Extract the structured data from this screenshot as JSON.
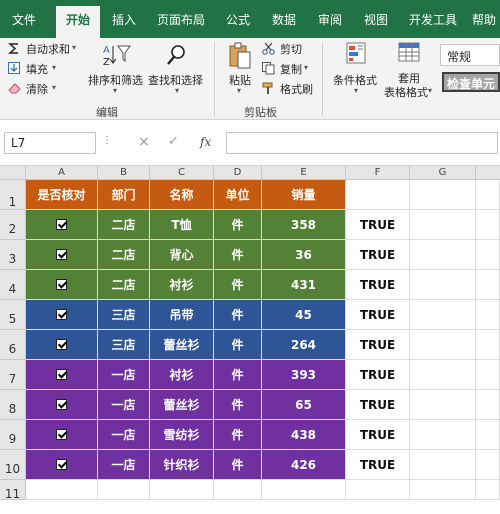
{
  "tabs": [
    "文件",
    "开始",
    "插入",
    "页面布局",
    "公式",
    "数据",
    "审阅",
    "视图",
    "开发工具",
    "帮助"
  ],
  "ribbon": {
    "autosum": "自动求和",
    "fill": "填充",
    "clear": "清除",
    "sort_filter": "排序和筛选",
    "find_select": "查找和选择",
    "editing_group": "编辑",
    "paste": "粘贴",
    "cut": "剪切",
    "copy": "复制",
    "format_painter": "格式刷",
    "clipboard_group": "剪贴板",
    "conditional_format": "条件格式",
    "table_format_line1": "套用",
    "table_format_line2": "表格格式",
    "number_format": "常规",
    "check_cell": "检查单元"
  },
  "formula_bar": {
    "name_box": "L7",
    "cancel": "×",
    "enter": "✓",
    "fx": "fx",
    "formula": ""
  },
  "columns": [
    "A",
    "B",
    "C",
    "D",
    "E",
    "F",
    "G"
  ],
  "rows": [
    "1",
    "2",
    "3",
    "4",
    "5",
    "6",
    "7",
    "8",
    "9",
    "10",
    "11"
  ],
  "headers": [
    "是否核对",
    "部门",
    "名称",
    "单位",
    "销量"
  ],
  "data": [
    {
      "dept": "二店",
      "name": "T恤",
      "unit": "件",
      "qty": "358",
      "f": "TRUE",
      "color": "#538135"
    },
    {
      "dept": "二店",
      "name": "背心",
      "unit": "件",
      "qty": "36",
      "f": "TRUE",
      "color": "#538135"
    },
    {
      "dept": "二店",
      "name": "衬衫",
      "unit": "件",
      "qty": "431",
      "f": "TRUE",
      "color": "#538135"
    },
    {
      "dept": "三店",
      "name": "吊带",
      "unit": "件",
      "qty": "45",
      "f": "TRUE",
      "color": "#2e5597"
    },
    {
      "dept": "三店",
      "name": "蕾丝衫",
      "unit": "件",
      "qty": "264",
      "f": "TRUE",
      "color": "#2e5597"
    },
    {
      "dept": "一店",
      "name": "衬衫",
      "unit": "件",
      "qty": "393",
      "f": "TRUE",
      "color": "#7030a0"
    },
    {
      "dept": "一店",
      "name": "蕾丝衫",
      "unit": "件",
      "qty": "65",
      "f": "TRUE",
      "color": "#7030a0"
    },
    {
      "dept": "一店",
      "name": "雪纺衫",
      "unit": "件",
      "qty": "438",
      "f": "TRUE",
      "color": "#7030a0"
    },
    {
      "dept": "一店",
      "name": "针织衫",
      "unit": "件",
      "qty": "426",
      "f": "TRUE",
      "color": "#7030a0"
    }
  ],
  "colors": {
    "header_bg": "#c55a11",
    "excel_green": "#217346"
  }
}
